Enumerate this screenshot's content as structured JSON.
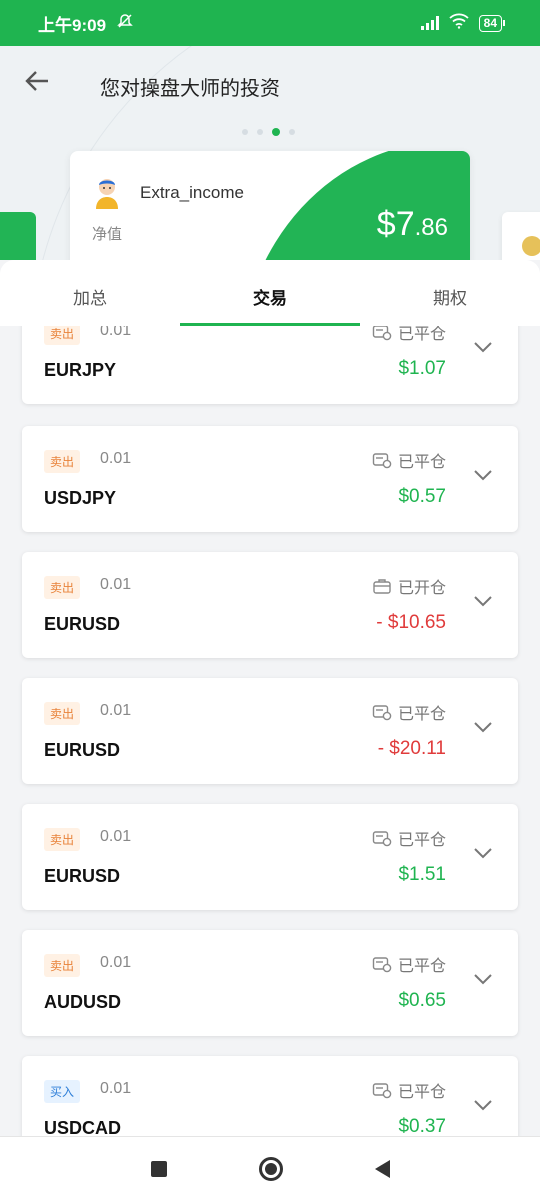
{
  "status": {
    "time": "上午9:09",
    "battery": "84"
  },
  "header": {
    "title": "您对操盘大师的投资"
  },
  "card": {
    "name": "Extra_income",
    "net_label": "净值",
    "value_main": "$7",
    "value_cents": ".86"
  },
  "tabs": [
    {
      "label": "加总"
    },
    {
      "label": "交易"
    },
    {
      "label": "期权"
    }
  ],
  "items": [
    {
      "side": "卖出",
      "lot": "0.01",
      "symbol": "EURJPY",
      "status": "已平仓",
      "amount": "$1.07",
      "type": "pos"
    },
    {
      "side": "卖出",
      "lot": "0.01",
      "symbol": "USDJPY",
      "status": "已平仓",
      "amount": "$0.57",
      "type": "pos"
    },
    {
      "side": "卖出",
      "lot": "0.01",
      "symbol": "EURUSD",
      "status": "已开仓",
      "amount": "- $10.65",
      "type": "neg"
    },
    {
      "side": "卖出",
      "lot": "0.01",
      "symbol": "EURUSD",
      "status": "已平仓",
      "amount": "- $20.11",
      "type": "neg"
    },
    {
      "side": "卖出",
      "lot": "0.01",
      "symbol": "EURUSD",
      "status": "已平仓",
      "amount": "$1.51",
      "type": "pos"
    },
    {
      "side": "卖出",
      "lot": "0.01",
      "symbol": "AUDUSD",
      "status": "已平仓",
      "amount": "$0.65",
      "type": "pos"
    },
    {
      "side": "买入",
      "lot": "0.01",
      "symbol": "USDCAD",
      "status": "已平仓",
      "amount": "$0.37",
      "type": "pos"
    }
  ],
  "colors": {
    "accent": "#1fb450",
    "negative": "#e03b3b"
  }
}
